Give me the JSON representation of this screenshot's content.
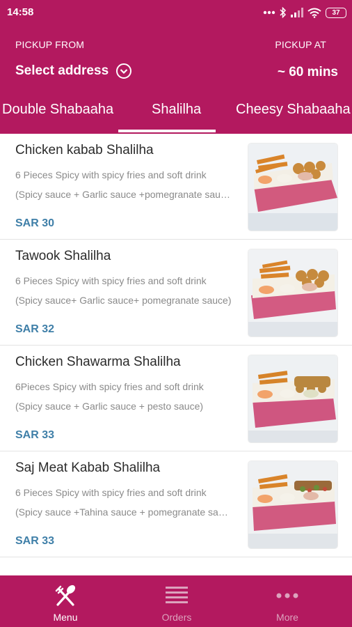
{
  "status_bar": {
    "time": "14:58",
    "battery": "37"
  },
  "header": {
    "pickup_from_label": "PICKUP FROM",
    "address": "Select address",
    "pickup_at_label": "PICKUP AT",
    "pickup_time": "~ 60 mins"
  },
  "tabs": [
    {
      "label": "Double Shabaaha",
      "selected": false
    },
    {
      "label": "Shalilha",
      "selected": true
    },
    {
      "label": "Cheesy Shabaaha",
      "selected": false
    }
  ],
  "menu_items": [
    {
      "name": "Chicken kabab  Shalilha",
      "desc1": "6 Pieces Spicy with spicy fries  and soft drink",
      "desc2": "(Spicy sauce + Garlic sauce +pomegranate sauce)",
      "price": "SAR 30"
    },
    {
      "name": "Tawook Shalilha",
      "desc1": "6 Pieces Spicy with spicy fries  and soft drink",
      "desc2": "(Spicy sauce+ Garlic sauce+ pomegranate sauce)",
      "price": "SAR 32"
    },
    {
      "name": "Chicken Shawarma Shalilha",
      "desc1": "6Pieces Spicy with spicy fries  and soft drink",
      "desc2": "(Spicy sauce + Garlic sauce + pesto sauce)",
      "price": "SAR 33"
    },
    {
      "name": "Saj Meat Kabab Shalilha",
      "desc1": "6 Pieces Spicy with spicy fries  and soft drink",
      "desc2": "(Spicy sauce +Tahina sauce + pomegranate sauce)",
      "price": "SAR 33"
    }
  ],
  "bottom_nav": [
    {
      "label": "Menu",
      "icon": "fork-spoon-icon",
      "active": true
    },
    {
      "label": "Orders",
      "icon": "list-icon",
      "active": false
    },
    {
      "label": "More",
      "icon": "more-dots-icon",
      "active": false
    }
  ],
  "colors": {
    "brand": "#b3195f",
    "price": "#3f7fa8",
    "inactive_nav": "#dca3bd"
  }
}
